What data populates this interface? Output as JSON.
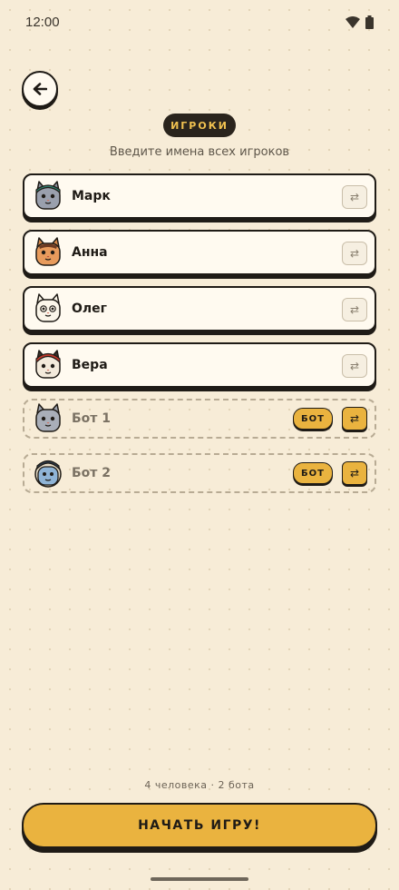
{
  "status_bar": {
    "time": "12:00",
    "icons": [
      "wifi-icon",
      "battery-icon"
    ]
  },
  "header": {
    "title": "ИГРОКИ",
    "subtitle": "Введите имена всех игроков",
    "back_icon": "arrow-left-icon"
  },
  "players": [
    {
      "name": "Марк",
      "bot": false,
      "avatar": "cat-teal-cap",
      "swap_icon": "⇄"
    },
    {
      "name": "Анна",
      "bot": false,
      "avatar": "cat-orange",
      "swap_icon": "⇄"
    },
    {
      "name": "Олег",
      "bot": false,
      "avatar": "cat-white",
      "swap_icon": "⇄"
    },
    {
      "name": "Вера",
      "bot": false,
      "avatar": "cat-red-cap",
      "swap_icon": "⇄"
    },
    {
      "name": "Бот 1",
      "bot": true,
      "badge": "БОТ",
      "avatar": "cat-grey",
      "swap_icon": "⇄"
    },
    {
      "name": "Бот 2",
      "bot": true,
      "badge": "БОТ",
      "avatar": "cat-blue-beanie",
      "swap_icon": "⇄"
    }
  ],
  "summary": "4 человека · 2 бота",
  "start_button": "НАЧАТЬ ИГРУ!",
  "colors": {
    "background": "#f7ecd7",
    "accent": "#eab33f",
    "ink": "#1f1b16",
    "title_text": "#f0c150"
  }
}
